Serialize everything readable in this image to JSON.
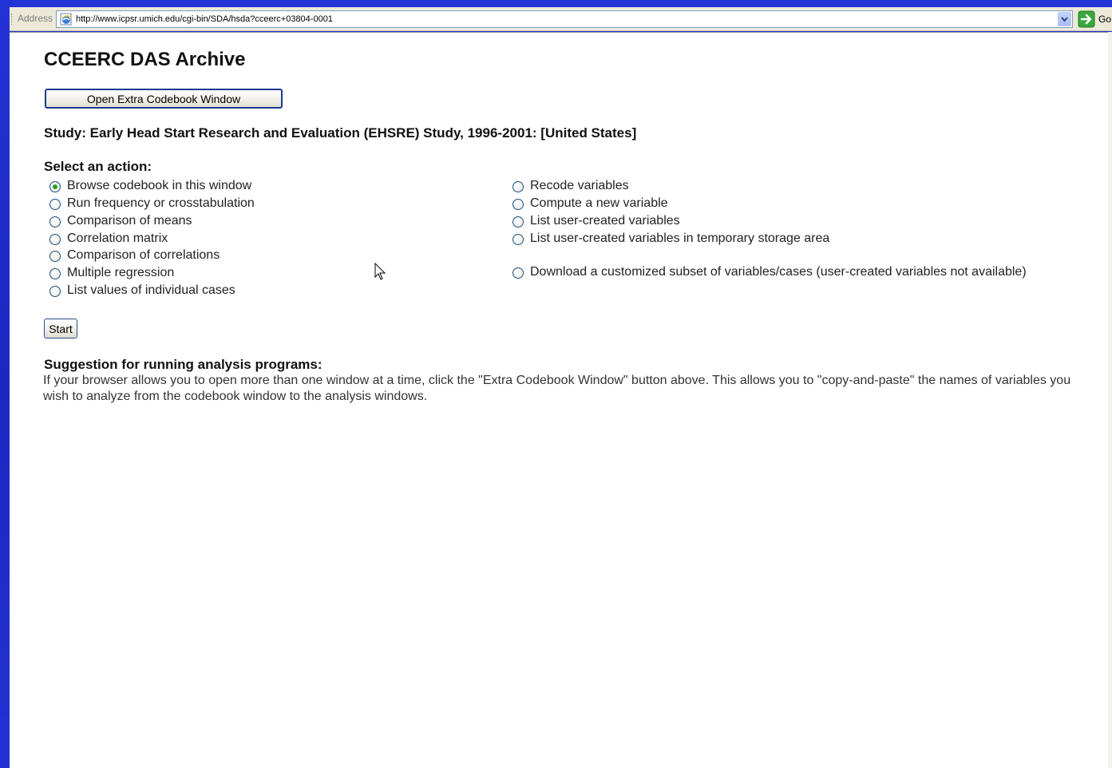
{
  "address_bar": {
    "label": "Address",
    "url": "http://www.icpsr.umich.edu/cgi-bin/SDA/hsda?cceerc+03804-0001",
    "go_label": "Go"
  },
  "page": {
    "title": "CCEERC DAS Archive",
    "extra_codebook_button": "Open Extra Codebook Window",
    "study": "Study: Early Head Start Research and Evaluation (EHSRE) Study, 1996-2001: [United States]",
    "select_label": "Select an action:",
    "actions_left": [
      {
        "label": "Browse codebook in this window",
        "checked": true
      },
      {
        "label": "Run frequency or crosstabulation",
        "checked": false
      },
      {
        "label": "Comparison of means",
        "checked": false
      },
      {
        "label": "Correlation matrix",
        "checked": false
      },
      {
        "label": "Comparison of correlations",
        "checked": false
      },
      {
        "label": "Multiple regression",
        "checked": false
      },
      {
        "label": "List values of individual cases",
        "checked": false
      }
    ],
    "actions_right": [
      {
        "label": "Recode variables",
        "checked": false
      },
      {
        "label": "Compute a new variable",
        "checked": false
      },
      {
        "label": "List user-created variables",
        "checked": false
      },
      {
        "label": "List user-created variables in temporary storage area",
        "checked": false
      },
      {
        "label": "Download a customized subset of variables/cases (user-created variables not available)",
        "checked": false
      }
    ],
    "start_button": "Start",
    "suggestion_title": "Suggestion for running analysis programs:",
    "suggestion_text": "If your browser allows you to open more than one window at a time, click the \"Extra Codebook Window\" button above. This allows you to \"copy-and-paste\" the names of variables you wish to analyze from the codebook window to the analysis windows."
  },
  "colors": {
    "desktop_blue": "#1f2dc8",
    "radio_checked": "#21a121",
    "go_green": "#3aa83a"
  }
}
